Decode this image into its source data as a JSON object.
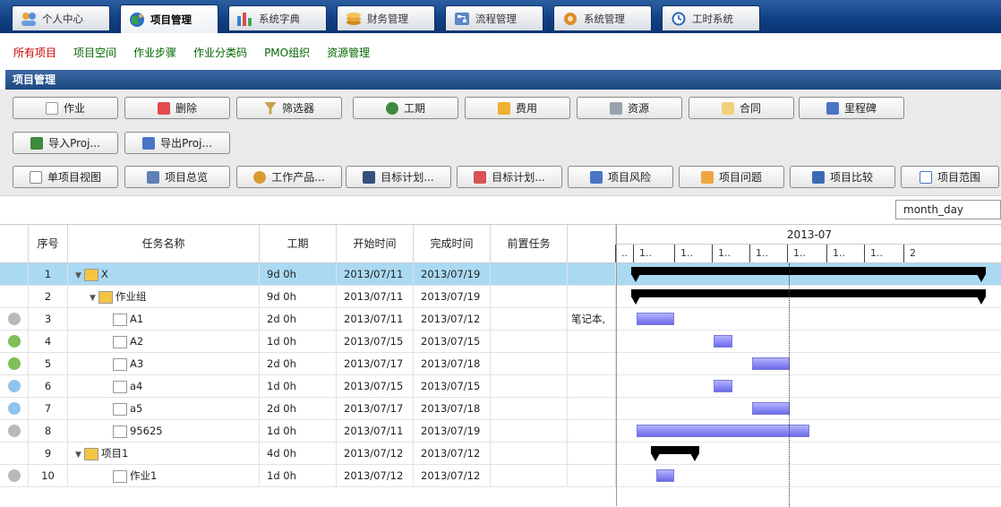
{
  "top_tabs": [
    {
      "label": "个人中心",
      "icon": "users-icon",
      "active": false
    },
    {
      "label": "项目管理",
      "icon": "globe-icon",
      "active": true
    },
    {
      "label": "系统字典",
      "icon": "bar-chart-icon",
      "active": false
    },
    {
      "label": "财务管理",
      "icon": "coins-icon",
      "active": false
    },
    {
      "label": "流程管理",
      "icon": "flow-icon",
      "active": false
    },
    {
      "label": "系统管理",
      "icon": "gear-icon",
      "active": false
    },
    {
      "label": "工时系统",
      "icon": "clock-icon",
      "active": false
    }
  ],
  "subnav": [
    "所有项目",
    "项目空间",
    "作业步骤",
    "作业分类码",
    "PMO组织",
    "资源管理"
  ],
  "section_title": "项目管理",
  "toolbar": {
    "row1": [
      "作业",
      "删除",
      "筛选器",
      "工期",
      "费用",
      "资源",
      "合同",
      "里程碑"
    ],
    "row2": [
      "导入Proj...",
      "导出Proj..."
    ],
    "row3": [
      "单项目视图",
      "项目总览",
      "工作产品...",
      "目标计划...",
      "目标计划...",
      "项目风险",
      "项目问题",
      "项目比较",
      "项目范围"
    ]
  },
  "zoom_select": "month_day",
  "columns": [
    "序号",
    "任务名称",
    "工期",
    "开始时间",
    "完成时间",
    "前置任务",
    ""
  ],
  "rows": [
    {
      "seq": "1",
      "name": "X",
      "duration": "9d 0h",
      "start": "2013/07/11",
      "end": "2013/07/19",
      "pred": "",
      "note": "",
      "type": "project",
      "status_icon": ""
    },
    {
      "seq": "2",
      "name": "作业组",
      "duration": "9d 0h",
      "start": "2013/07/11",
      "end": "2013/07/19",
      "pred": "",
      "note": "",
      "type": "group",
      "status_icon": ""
    },
    {
      "seq": "3",
      "name": "A1",
      "duration": "2d 0h",
      "start": "2013/07/11",
      "end": "2013/07/12",
      "pred": "",
      "note": "笔记本,",
      "type": "task",
      "status_icon": "pencil-status-icon"
    },
    {
      "seq": "4",
      "name": "A2",
      "duration": "1d 0h",
      "start": "2013/07/15",
      "end": "2013/07/15",
      "pred": "",
      "note": "",
      "type": "task",
      "status_icon": "add-status-icon"
    },
    {
      "seq": "5",
      "name": "A3",
      "duration": "2d 0h",
      "start": "2013/07/17",
      "end": "2013/07/18",
      "pred": "",
      "note": "",
      "type": "task",
      "status_icon": "add-status-icon"
    },
    {
      "seq": "6",
      "name": "a4",
      "duration": "1d 0h",
      "start": "2013/07/15",
      "end": "2013/07/15",
      "pred": "",
      "note": "",
      "type": "task",
      "status_icon": "bulb-status-icon"
    },
    {
      "seq": "7",
      "name": "a5",
      "duration": "2d 0h",
      "start": "2013/07/17",
      "end": "2013/07/18",
      "pred": "",
      "note": "",
      "type": "task",
      "status_icon": "bulb-status-icon"
    },
    {
      "seq": "8",
      "name": "95625",
      "duration": "1d 0h",
      "start": "2013/07/11",
      "end": "2013/07/19",
      "pred": "",
      "note": "",
      "type": "task",
      "status_icon": "pencil-status-icon"
    },
    {
      "seq": "9",
      "name": "项目1",
      "duration": "4d 0h",
      "start": "2013/07/12",
      "end": "2013/07/12",
      "pred": "",
      "note": "",
      "type": "project",
      "status_icon": ""
    },
    {
      "seq": "10",
      "name": "作业1",
      "duration": "1d 0h",
      "start": "2013/07/12",
      "end": "2013/07/12",
      "pred": "",
      "note": "",
      "type": "task",
      "status_icon": "pencil-status-icon"
    }
  ],
  "gantt": {
    "month_label": "2013-07",
    "tick_labels": [
      "..",
      "1..",
      "1..",
      "1..",
      "1..",
      "1..",
      "1..",
      "1..",
      "2"
    ]
  },
  "colors": {
    "accent": "#1c477f",
    "selected_row": "#aad9f2",
    "bar": "#8f8ff5",
    "subnav_active": "#cc0000",
    "subnav": "#006600"
  }
}
